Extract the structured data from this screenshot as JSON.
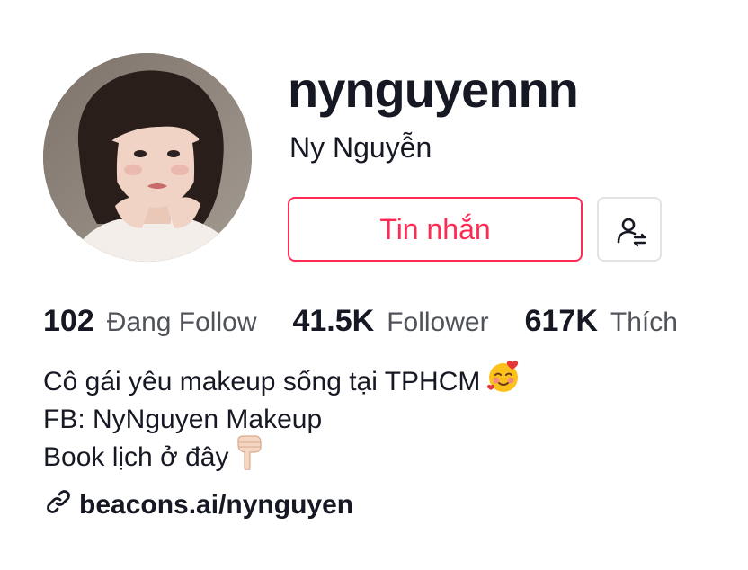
{
  "profile": {
    "username": "nynguyennn",
    "display_name": "Ny Nguyễn",
    "avatar_icon": "profile-photo"
  },
  "actions": {
    "message_label": "Tin nhắn",
    "follow_icon": "user-swap-icon"
  },
  "stats": [
    {
      "value": "102",
      "label": "Đang Follow"
    },
    {
      "value": "41.5K",
      "label": "Follower"
    },
    {
      "value": "617K",
      "label": "Thích"
    }
  ],
  "bio": {
    "line1": "Cô gái yêu makeup sống tại TPHCM",
    "line2": "FB: NyNguyen Makeup",
    "line3": "Book lịch ở đây"
  },
  "link": {
    "text": "beacons.ai/nynguyen",
    "icon": "link-icon"
  },
  "colors": {
    "accent": "#fe2c55",
    "text": "#161823",
    "border": "#e3e3e4"
  }
}
